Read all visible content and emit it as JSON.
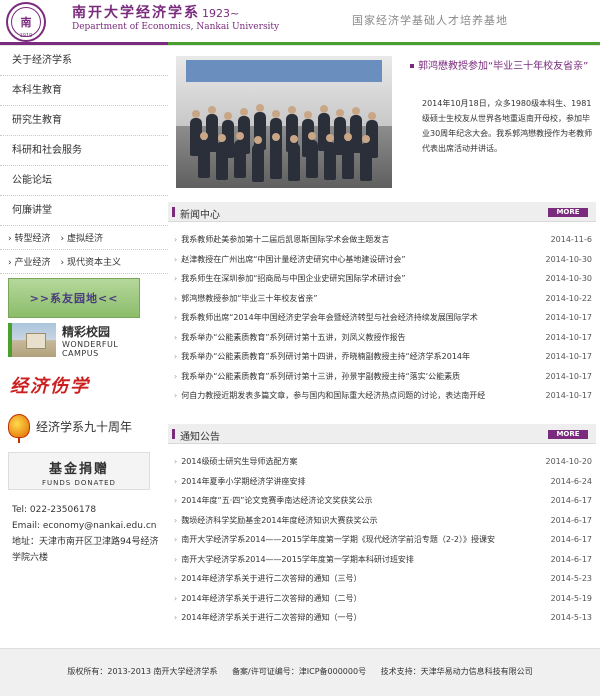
{
  "header": {
    "logo_cn": "南开大学经济学系",
    "logo_year": "1923~",
    "logo_en": "Department of Economics, Nankai University",
    "seal_year": "1919",
    "slogan": "国家经济学基础人才培养基地"
  },
  "sidebar": {
    "nav": [
      {
        "label": "关于经济学系"
      },
      {
        "label": "本科生教育"
      },
      {
        "label": "研究生教育"
      },
      {
        "label": "科研和社会服务"
      },
      {
        "label": "公能论坛"
      },
      {
        "label": "何廉讲堂"
      }
    ],
    "sub_rows": [
      [
        "转型经济",
        "虚拟经济"
      ],
      [
        "产业经济",
        "现代资本主义"
      ]
    ],
    "banners": {
      "alumni": ">>系友园地<<",
      "campus_cn": "精彩校园",
      "campus_en": "WONDERFUL CAMPUS",
      "calligraphy": "经济伤学",
      "anniversary": "经济学系九十周年",
      "donate_cn": "基金捐赠",
      "donate_en": "FUNDS DONATED"
    },
    "contact": {
      "tel": "Tel:  022-23506178",
      "email": "Email: economy@nankai.edu.cn",
      "address": "地址：天津市南开区卫津路94号经济学院六楼"
    }
  },
  "feature": {
    "title": "郭鸿懋教授参加“毕业三十年校友省亲”",
    "body": "2014年10月18日，众多1980级本科生、1981级硕士生校友从世界各地重返南开母校，参加毕业30周年纪念大会。我系郭鸿懋教授作为老教师代表出席活动并讲话。"
  },
  "news": {
    "title": "新闻中心",
    "more": "MORE",
    "items": [
      {
        "text": "我系教师赴美参加第十二届后凯恩斯国际学术会做主题发言",
        "date": "2014-11-6"
      },
      {
        "text": "赵津教授在广州出席“中国计量经济史研究中心基地建设研讨会”",
        "date": "2014-10-30"
      },
      {
        "text": "我系师生在深圳参加“招商局与中国企业史研究国际学术研讨会”",
        "date": "2014-10-30"
      },
      {
        "text": "郭鸿懋教授参加“毕业三十年校友省亲”",
        "date": "2014-10-22"
      },
      {
        "text": "我系教师出席“2014年中国经济史学会年会暨经济转型与社会经济持续发展国际学术",
        "date": "2014-10-17"
      },
      {
        "text": "我系举办“公能素质教育”系列研讨第十五讲，刘凤义教授作报告",
        "date": "2014-10-17"
      },
      {
        "text": "我系举办“公能素质教育”系列研讨第十四讲，乔晓楠副教授主持“经济学系2014年",
        "date": "2014-10-17"
      },
      {
        "text": "我系举办“公能素质教育”系列研讨第十三讲，孙景宇副教授主持“落实‘公能素质",
        "date": "2014-10-17"
      },
      {
        "text": "何自力教授近期发表多篇文章，参与国内和国际重大经济热点问题的讨论，表达南开经",
        "date": "2014-10-17"
      }
    ]
  },
  "notices": {
    "title": "通知公告",
    "more": "MORE",
    "items": [
      {
        "text": "2014级硕士研究生导师选配方案",
        "date": "2014-10-20"
      },
      {
        "text": "2014年夏季小学期经济学讲座安排",
        "date": "2014-6-24"
      },
      {
        "text": "2014年度“五·四”论文竞赛季南达经济论文奖获奖公示",
        "date": "2014-6-17"
      },
      {
        "text": "魏埙经济科学奖励基金2014年度经济知识大赛获奖公示",
        "date": "2014-6-17"
      },
      {
        "text": "南开大学经济学系2014——2015学年度第一学期《现代经济学前沿专题（2-2）》授课安",
        "date": "2014-6-17"
      },
      {
        "text": "南开大学经济学系2014——2015学年度第一学期本科研讨班安排",
        "date": "2014-6-17"
      },
      {
        "text": "2014年经济学系关于进行二次答辩的通知（三号）",
        "date": "2014-5-23"
      },
      {
        "text": "2014年经济学系关于进行二次答辩的通知（二号）",
        "date": "2014-5-19"
      },
      {
        "text": "2014年经济学系关于进行二次答辩的通知（一号）",
        "date": "2014-5-13"
      }
    ]
  },
  "footer": {
    "copyright": "版权所有：2013-2013 南开大学经济学系",
    "icp": "备案/许可证编号：津ICP备000000号",
    "support": "技术支持：天津华易动力信息科技有限公司"
  },
  "colors": {
    "brand_purple": "#7a2b7d",
    "accent_green": "#4aa02c"
  }
}
